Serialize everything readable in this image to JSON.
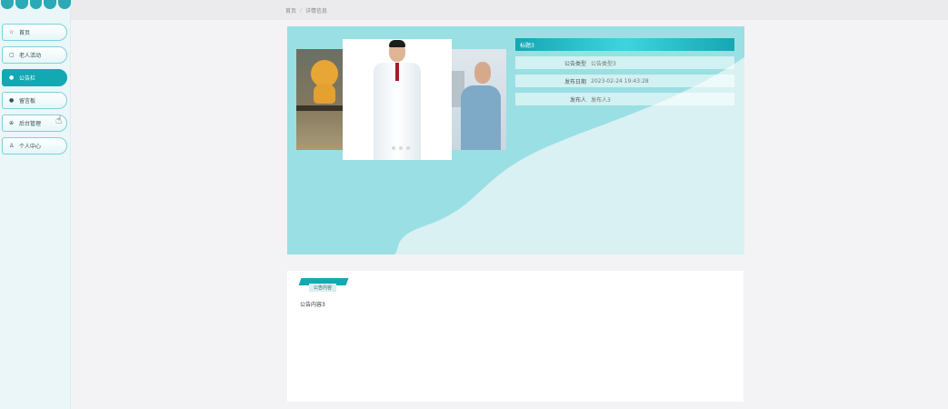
{
  "sidebar": {
    "items": [
      {
        "label": "首页",
        "icon": "home-icon",
        "active": false
      },
      {
        "label": "老人活动",
        "icon": "calendar-icon",
        "active": false
      },
      {
        "label": "公告栏",
        "icon": "bullet-icon",
        "active": true
      },
      {
        "label": "留言板",
        "icon": "bullet-icon",
        "active": false
      },
      {
        "label": "后台管理",
        "icon": "admin-icon",
        "active": false
      },
      {
        "label": "个人中心",
        "icon": "user-icon",
        "active": false
      }
    ]
  },
  "breadcrumb": {
    "home": "首页",
    "current": "详情信息"
  },
  "detail": {
    "title": "标题3",
    "rows": [
      {
        "key": "公告类型",
        "value": "公告类型3"
      },
      {
        "key": "发布日期",
        "value": "2023-02-24 19:43:28"
      },
      {
        "key": "发布人",
        "value": "发布人3"
      }
    ]
  },
  "content": {
    "tag": "公告内容",
    "text": "公告内容3"
  },
  "colors": {
    "accent": "#14a8b3",
    "hero_bg": "#9adfe3",
    "page_bg": "#f3f3f5"
  }
}
